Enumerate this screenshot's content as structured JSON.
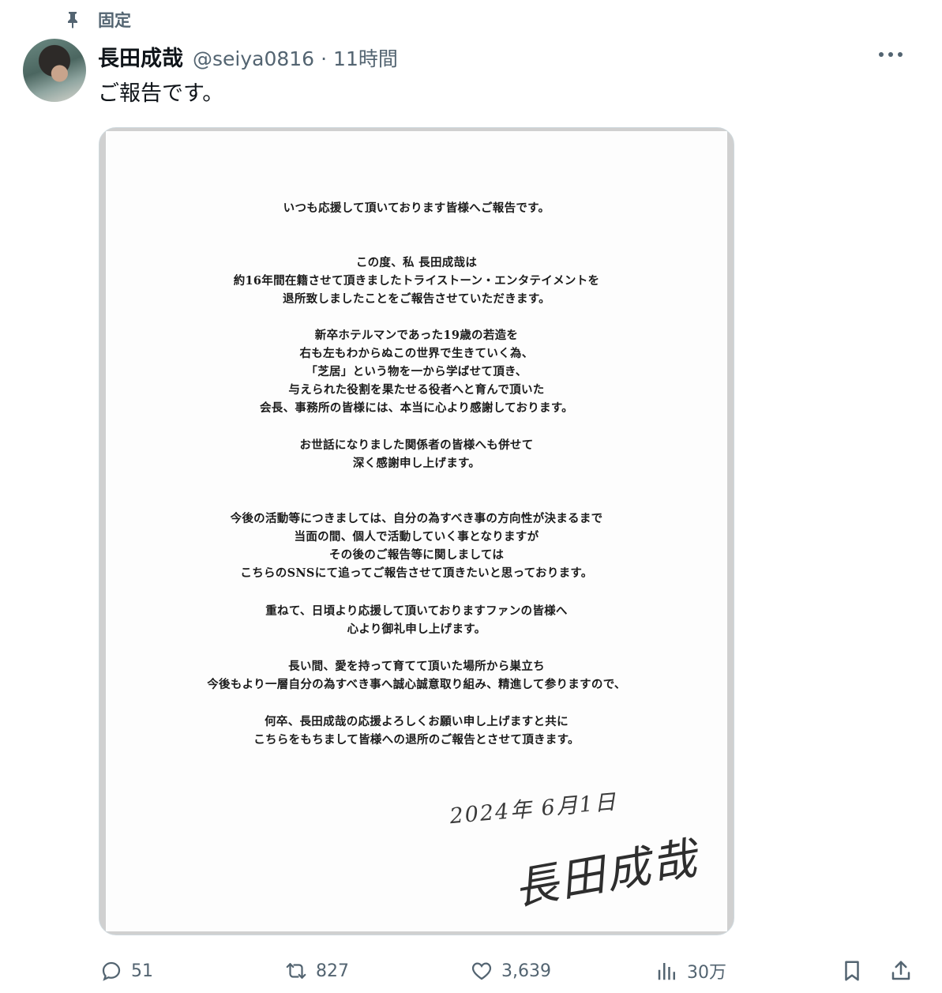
{
  "pinned": {
    "label": "固定",
    "icon": "pin-icon"
  },
  "author": {
    "display_name": "長田成哉",
    "handle": "@seiya0816",
    "separator": "·",
    "timestamp": "11時間",
    "avatar": "avatar"
  },
  "tweet": {
    "text": "ご報告です。",
    "more_icon": "more-icon"
  },
  "media": {
    "letter_lines": [
      "いつも応援して頂いております皆様へご報告です。",
      "この度、私 長田成哉は",
      "約16年間在籍させて頂きましたトライストーン・エンタテイメントを",
      "退所致しましたことをご報告させていただきます。",
      "新卒ホテルマンであった19歳の若造を",
      "右も左もわからぬこの世界で生きていく為、",
      "「芝居」という物を一から学ばせて頂き、",
      "与えられた役割を果たせる役者へと育んで頂いた",
      "会長、事務所の皆様には、本当に心より感謝しております。",
      "お世話になりました関係者の皆様へも併せて",
      "深く感謝申し上げます。",
      "今後の活動等につきましては、自分の為すべき事の方向性が決まるまで",
      "当面の間、個人で活動していく事となりますが",
      "その後のご報告等に関しましては",
      "こちらのSNSにて追ってご報告させて頂きたいと思っております。",
      "重ねて、日頃より応援して頂いておりますファンの皆様へ",
      "心より御礼申し上げます。",
      "長い間、愛を持って育てて頂いた場所から巣立ち",
      "今後もより一層自分の為すべき事へ誠心誠意取り組み、精進して参りますので、",
      "何卒、長田成哉の応援よろしくお願い申し上げますと共に",
      "こちらをもちまして皆様への退所のご報告とさせて頂きます。"
    ],
    "handwritten_date": "2024年 6月1日",
    "signature": "長田成哉"
  },
  "actions": {
    "reply": {
      "icon": "reply-icon",
      "count": "51"
    },
    "retweet": {
      "icon": "retweet-icon",
      "count": "827"
    },
    "like": {
      "icon": "heart-icon",
      "count": "3,639"
    },
    "views": {
      "icon": "views-icon",
      "count": "30万"
    },
    "bookmark": {
      "icon": "bookmark-icon"
    },
    "share": {
      "icon": "share-icon"
    }
  }
}
